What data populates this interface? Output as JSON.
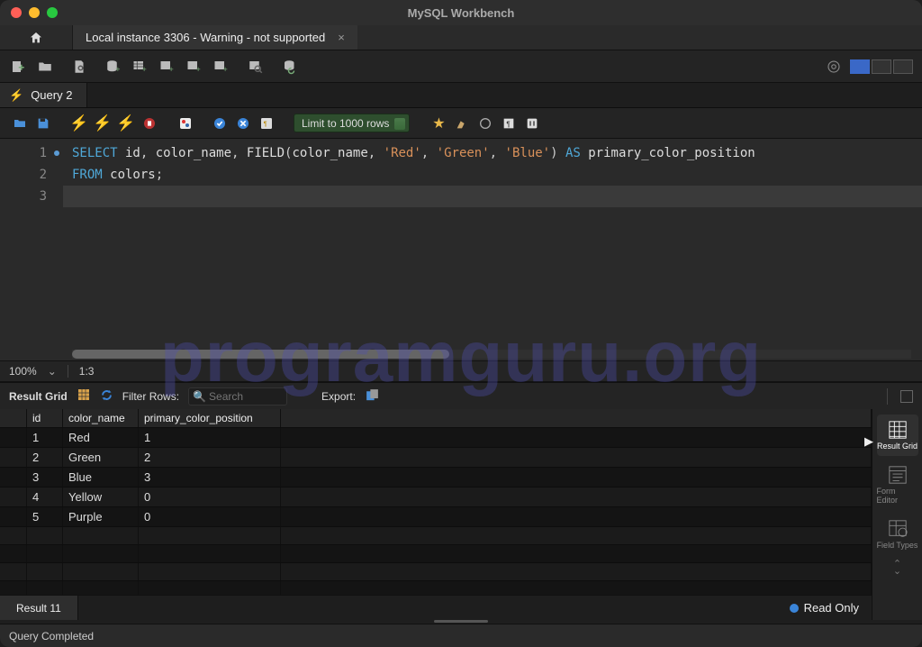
{
  "title": "MySQL Workbench",
  "tabs": {
    "connection": "Local instance 3306 - Warning - not supported"
  },
  "queryTab": {
    "label": "Query 2"
  },
  "queryToolbar": {
    "limit": "Limit to 1000 rows"
  },
  "sql": {
    "line1": {
      "k1": "SELECT",
      "id1": " id",
      "p1": ", ",
      "id2": "color_name",
      "p2": ", ",
      "fn": "FIELD",
      "p3": "(",
      "arg1": "color_name",
      "p4": ", ",
      "s1": "'Red'",
      "p5": ", ",
      "s2": "'Green'",
      "p6": ", ",
      "s3": "'Blue'",
      "p7": ") ",
      "k2": "AS",
      "id3": " primary_color_position"
    },
    "line2": {
      "k1": "FROM",
      "id1": " colors",
      "p1": ";"
    }
  },
  "editorStatus": {
    "zoom": "100%",
    "pos": "1:3"
  },
  "resultHeader": {
    "label": "Result Grid",
    "filterLabel": "Filter Rows:",
    "searchPlaceholder": "Search",
    "exportLabel": "Export:"
  },
  "grid": {
    "headers": [
      "id",
      "color_name",
      "primary_color_position"
    ],
    "rows": [
      [
        "1",
        "Red",
        "1"
      ],
      [
        "2",
        "Green",
        "2"
      ],
      [
        "3",
        "Blue",
        "3"
      ],
      [
        "4",
        "Yellow",
        "0"
      ],
      [
        "5",
        "Purple",
        "0"
      ]
    ]
  },
  "sidePanel": {
    "items": [
      "Result Grid",
      "Form Editor",
      "Field Types"
    ]
  },
  "resultTab": "Result 11",
  "readOnly": "Read Only",
  "footer": "Query Completed",
  "watermark": "programguru.org"
}
